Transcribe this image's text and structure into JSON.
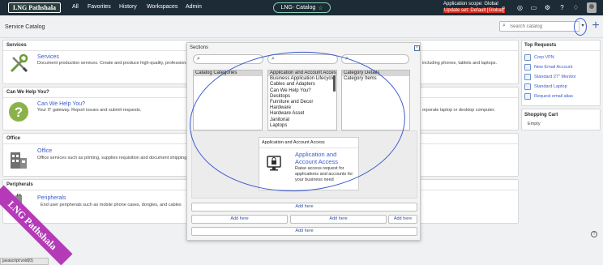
{
  "topbar": {
    "logo_text": "LNG Pathshala",
    "nav": [
      "All",
      "Favorites",
      "History",
      "Workspaces",
      "Admin"
    ],
    "app_center": "LNG- Catalog",
    "scope_line1": "Application scope: Global",
    "scope_line2": "Update set: Default [Global]",
    "icons": [
      "globe-icon",
      "search-icon",
      "chat-icon",
      "help-icon",
      "notifications-icon"
    ]
  },
  "header": {
    "title": "Service Catalog",
    "search_placeholder": "Search catalog",
    "add_symbol": "+"
  },
  "categories": [
    {
      "section": "Services",
      "name": "Services",
      "desc": "Document production services. Create and produce high-quality, professional",
      "desc_right": "including phones, tablets and laptops.",
      "icon": "wrench-screwdriver-icon"
    },
    {
      "section": "Can We Help You?",
      "name": "Can We Help You?",
      "desc": "Your IT gateway. Report issues and submit requests.",
      "desc_right": "orporate laptop or desktop computer.",
      "icon": "question-icon"
    },
    {
      "section": "Office",
      "name": "Office",
      "desc": "Office services such as printing, supplies requisition and document shipping",
      "desc_right": "",
      "icon": "office-building-icon"
    },
    {
      "section": "Peripherals",
      "name": "Peripherals",
      "desc": "End user peripherals such as mobile phone cases, dongles, and cables",
      "desc_right": "",
      "icon": "cable-icon"
    }
  ],
  "top_requests": {
    "title": "Top Requests",
    "items": [
      "Corp VPN",
      "New Email Account",
      "Standard 27\" Monitor",
      "Standard Laptop",
      "Request email alias"
    ]
  },
  "shopping_cart": {
    "title": "Shopping Cart",
    "empty_text": "Empty"
  },
  "dialog": {
    "title": "Sections",
    "close_symbol": "×",
    "list1": [
      "Catalog Categories"
    ],
    "list2": [
      "Application and Account Access",
      "Business Application Lifecycle",
      "Cables and Adapters",
      "Can We Help You?",
      "Desktops",
      "Furniture and Decor",
      "Hardware",
      "Hardware Asset",
      "Janitorial",
      "Laptops"
    ],
    "list3": [
      "Category Details",
      "Category Items"
    ],
    "preview": {
      "header": "Application and Account Access",
      "name": "Application and Account Access",
      "desc": "Raise access request for applications and accounts for your business need"
    },
    "buttons": {
      "add_here_top": "Add here",
      "add_here_left": "Add here",
      "add_here_mid": "Add here",
      "add_here_right": "Add here",
      "add_here_bottom": "Add here"
    }
  },
  "watermark": "LNG Pathshala",
  "status_url": "javascript:void(0)"
}
